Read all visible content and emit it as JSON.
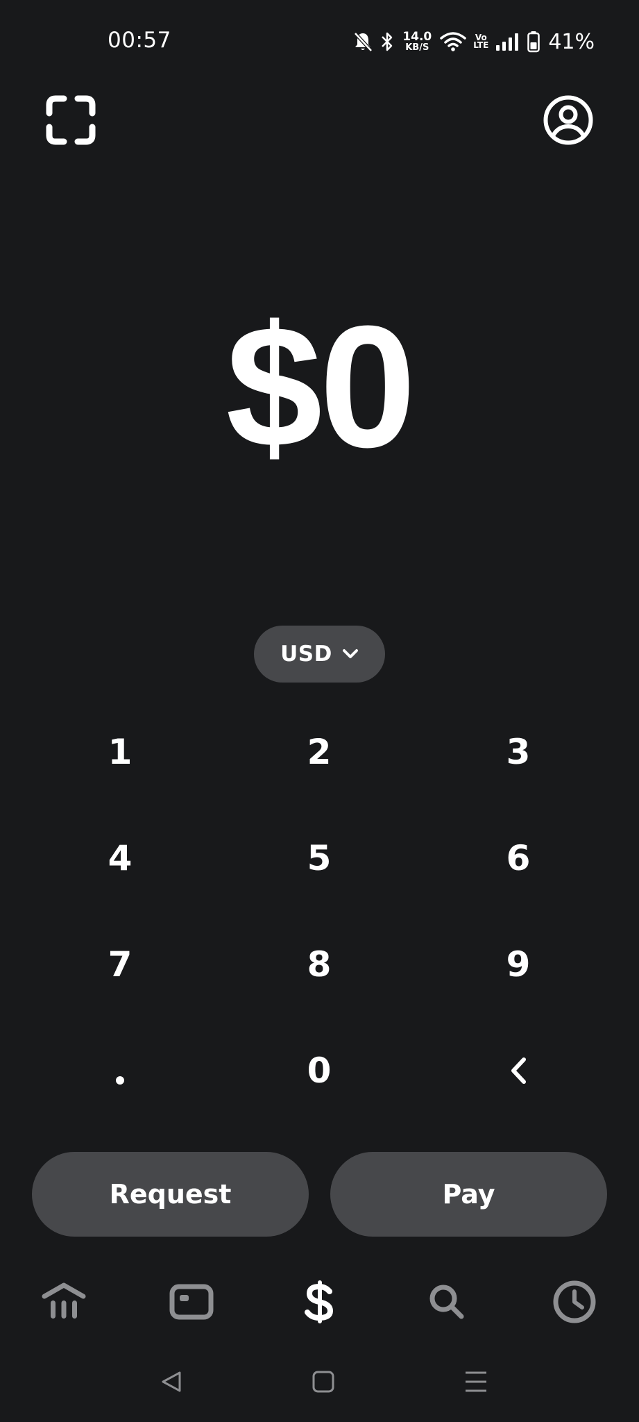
{
  "status_bar": {
    "time": "00:57",
    "net_speed_value": "14.0",
    "net_speed_unit": "KB/S",
    "volte_top": "Vo",
    "volte_bottom": "LTE",
    "battery_percent": "41%",
    "icons": [
      "bell-muted-icon",
      "bluetooth-icon",
      "wifi-icon",
      "signal-icon",
      "battery-icon"
    ]
  },
  "header": {
    "left_icon": "scan-icon",
    "right_icon": "profile-icon"
  },
  "amount": {
    "display": "$0"
  },
  "currency": {
    "label": "USD",
    "icon": "chevron-down-icon"
  },
  "keypad": {
    "keys": [
      "1",
      "2",
      "3",
      "4",
      "5",
      "6",
      "7",
      "8",
      "9",
      ".",
      "0",
      "<"
    ]
  },
  "actions": {
    "request_label": "Request",
    "pay_label": "Pay"
  },
  "bottom_nav": {
    "items": [
      {
        "icon": "bank-icon",
        "active": false
      },
      {
        "icon": "card-icon",
        "active": false
      },
      {
        "icon": "dollar-icon",
        "active": true
      },
      {
        "icon": "search-icon",
        "active": false
      },
      {
        "icon": "clock-icon",
        "active": false
      }
    ]
  },
  "system_nav": {
    "icons": [
      "back-icon",
      "home-icon",
      "recents-icon"
    ]
  },
  "colors": {
    "background": "#18191b",
    "pill": "#47484b",
    "text": "#ffffff",
    "nav_inactive": "#8e8f92"
  }
}
